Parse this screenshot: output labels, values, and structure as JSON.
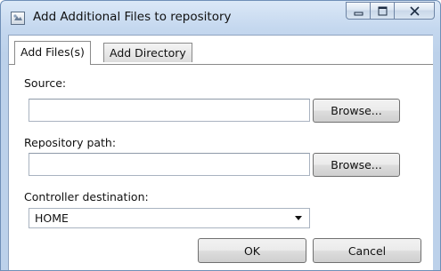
{
  "window": {
    "title": "Add Additional Files to repository",
    "icon": "app-icon",
    "controls": [
      "minimize-icon",
      "maximize-icon",
      "close-icon"
    ]
  },
  "tabs": [
    {
      "label": "Add Files(s)",
      "active": true
    },
    {
      "label": "Add Directory",
      "active": false
    }
  ],
  "form": {
    "source_label": "Source:",
    "source_value": "",
    "repo_path_label": "Repository path:",
    "repo_path_value": "",
    "browse_label": "Browse...",
    "controller_label": "Controller destination:",
    "controller_value": "HOME"
  },
  "buttons": {
    "ok": "OK",
    "cancel": "Cancel"
  }
}
